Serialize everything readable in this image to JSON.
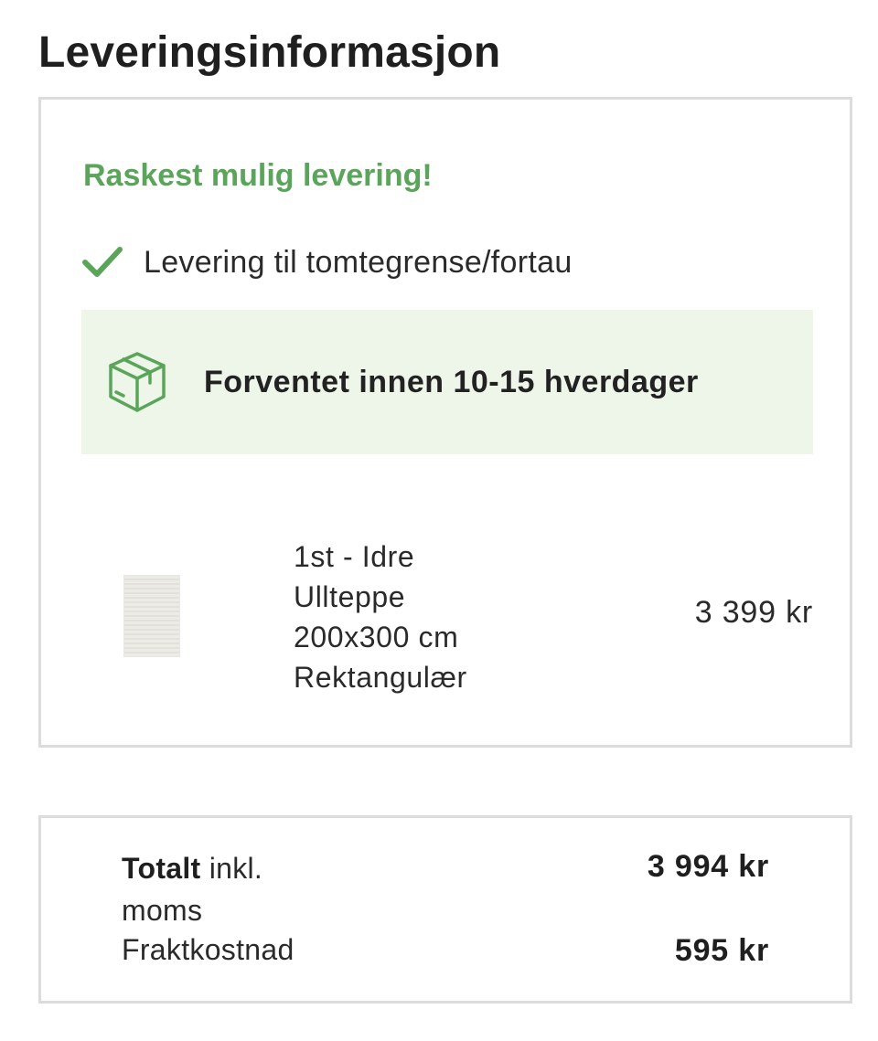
{
  "page": {
    "title": "Leveringsinformasjon"
  },
  "delivery": {
    "headline": "Raskest mulig levering!",
    "method_icon": "check-icon",
    "method_label": "Levering til tomtegrense/fortau",
    "eta_icon": "box-icon",
    "eta_label": "Forventet innen 10-15 hverdager",
    "colors": {
      "accent": "#5aa55a",
      "eta_background": "#eef6ea"
    }
  },
  "product": {
    "lines": [
      "1st - Idre",
      "Ullteppe",
      "200x300 cm",
      "Rektangulær"
    ],
    "price": "3 399 kr"
  },
  "totals": {
    "total_label_bold": "Totalt",
    "total_label_rest": " inkl. moms",
    "total_value": "3 994 kr",
    "shipping_label": "Fraktkostnad",
    "shipping_value": "595 kr"
  }
}
